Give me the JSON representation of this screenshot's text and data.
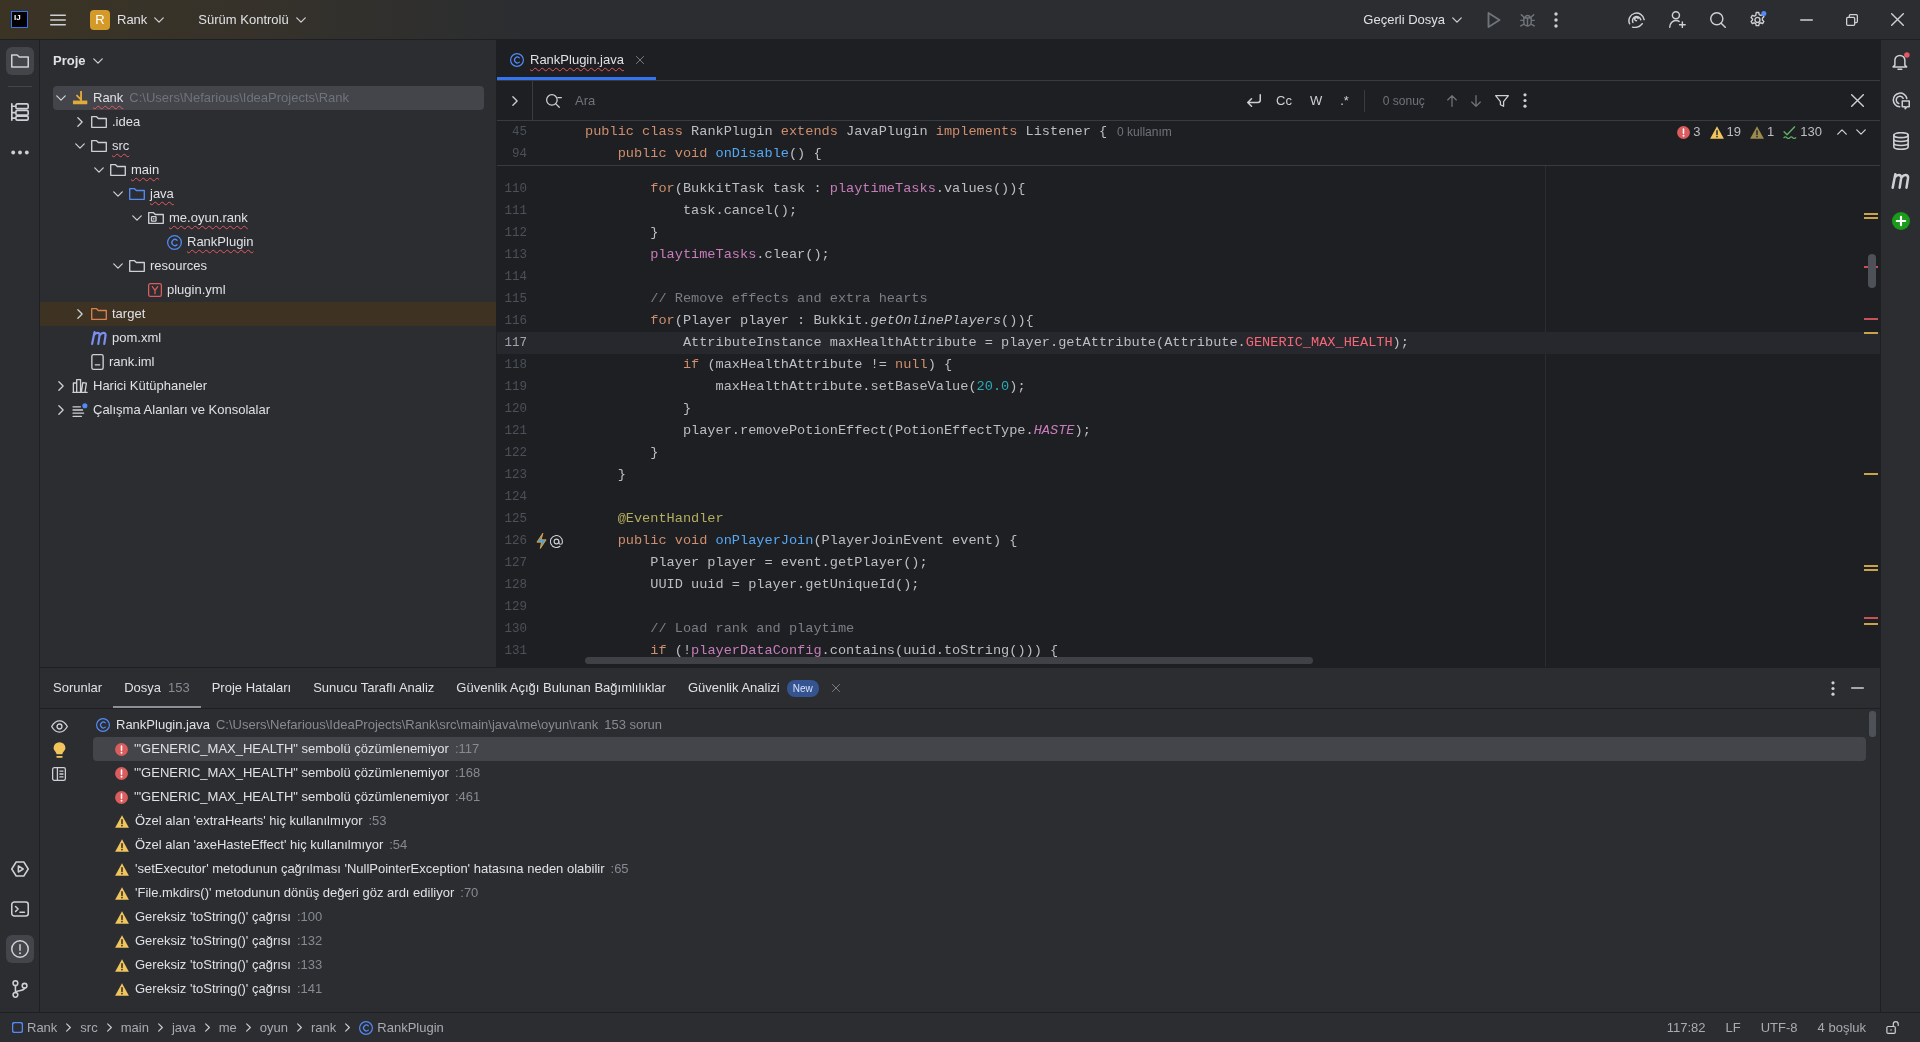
{
  "title_bar": {
    "logo": "IJ",
    "project_badge": "R",
    "project_name": "Rank",
    "vcs_menu": "Sürüm Kontrolü",
    "run_configuration": "Geçerli Dosya",
    "actions": [
      {
        "kind": "run",
        "disabled": true
      },
      {
        "kind": "debug",
        "disabled": true
      }
    ]
  },
  "left_toolbar": {
    "top": [
      {
        "kind": "project",
        "selected": true
      },
      {
        "kind": "structure",
        "selected": false
      },
      {
        "kind": "more",
        "selected": false
      }
    ],
    "bottom": [
      {
        "kind": "services",
        "selected": false
      },
      {
        "kind": "terminal",
        "selected": false
      },
      {
        "kind": "problems",
        "selected": true
      },
      {
        "kind": "git",
        "selected": false
      }
    ]
  },
  "project_panel": {
    "title": "Proje",
    "tree": [
      {
        "label": "Rank",
        "path": "C:\\Users\\Nefarious\\IdeaProjects\\Rank",
        "kind": "module",
        "expanded": true,
        "selected": true,
        "error": true,
        "children": [
          {
            "label": ".idea",
            "kind": "folder",
            "expanded": false,
            "selected": false,
            "error": false
          },
          {
            "label": "src",
            "kind": "folder",
            "expanded": true,
            "selected": false,
            "error": true,
            "children": [
              {
                "label": "main",
                "kind": "folder",
                "expanded": true,
                "selected": false,
                "error": true,
                "children": [
                  {
                    "label": "java",
                    "kind": "source-folder",
                    "expanded": true,
                    "selected": false,
                    "error": true,
                    "children": [
                      {
                        "label": "me.oyun.rank",
                        "kind": "package",
                        "expanded": true,
                        "selected": false,
                        "error": true,
                        "children": [
                          {
                            "label": "RankPlugin",
                            "kind": "class",
                            "selected": false,
                            "error": true
                          }
                        ]
                      }
                    ]
                  },
                  {
                    "label": "resources",
                    "kind": "folder",
                    "expanded": true,
                    "selected": false,
                    "error": false,
                    "children": [
                      {
                        "label": "plugin.yml",
                        "kind": "yaml",
                        "selected": false,
                        "error": false
                      }
                    ]
                  }
                ]
              }
            ]
          },
          {
            "label": "target",
            "kind": "excluded-folder",
            "expanded": false,
            "selected": false,
            "error": false
          },
          {
            "label": "pom.xml",
            "kind": "maven",
            "selected": false,
            "error": false
          },
          {
            "label": "rank.iml",
            "kind": "file",
            "selected": false,
            "error": false
          }
        ]
      },
      {
        "label": "Harici Kütüphaneler",
        "kind": "library",
        "expanded": false,
        "selected": false,
        "error": false
      },
      {
        "label": "Çalışma Alanları ve Konsolalar",
        "kind": "scratches",
        "expanded": false,
        "selected": false,
        "error": false
      }
    ]
  },
  "editor": {
    "tabs": [
      {
        "label": "RankPlugin.java",
        "kind": "class",
        "selected": true,
        "error": true
      }
    ],
    "find_bar": {
      "placeholder": "Ara",
      "options": [
        "Cc",
        "W",
        ".*"
      ],
      "result": "0 sonuç"
    },
    "sticky_lines": [
      {
        "number": "45",
        "tokens": [
          {
            "kind": "keyword",
            "text": "public class "
          },
          {
            "kind": "plain",
            "text": "RankPlugin "
          },
          {
            "kind": "keyword",
            "text": "extends "
          },
          {
            "kind": "plain",
            "text": "JavaPlugin "
          },
          {
            "kind": "keyword",
            "text": "implements "
          },
          {
            "kind": "plain",
            "text": "Listener {"
          }
        ],
        "hint": "0 kullanım"
      },
      {
        "number": "94",
        "tokens": [
          {
            "kind": "keyword",
            "text": "    public void "
          },
          {
            "kind": "method_declaration",
            "text": "onDisable"
          },
          {
            "kind": "plain",
            "text": "() {"
          }
        ]
      }
    ],
    "inspections": [
      {
        "kind": "error",
        "count": "3"
      },
      {
        "kind": "warning",
        "count": "19"
      },
      {
        "kind": "weak_warning",
        "count": "1"
      },
      {
        "kind": "typo",
        "count": "130"
      }
    ],
    "lines": [
      {
        "number": "110",
        "current": false,
        "tokens": [
          {
            "kind": "keyword",
            "text": "        for"
          },
          {
            "kind": "plain",
            "text": "(BukkitTask task : "
          },
          {
            "kind": "field",
            "text": "playtimeTasks"
          },
          {
            "kind": "plain",
            "text": ".values()){"
          }
        ]
      },
      {
        "number": "111",
        "current": false,
        "tokens": [
          {
            "kind": "plain",
            "text": "            task.cancel();"
          }
        ]
      },
      {
        "number": "112",
        "current": false,
        "tokens": [
          {
            "kind": "plain",
            "text": "        }"
          }
        ]
      },
      {
        "number": "113",
        "current": false,
        "tokens": [
          {
            "kind": "field",
            "text": "        playtimeTasks"
          },
          {
            "kind": "plain",
            "text": ".clear();"
          }
        ]
      },
      {
        "number": "114",
        "current": false
      },
      {
        "number": "115",
        "current": false,
        "tokens": [
          {
            "kind": "comment",
            "text": "        // Remove effects and extra hearts"
          }
        ]
      },
      {
        "number": "116",
        "current": false,
        "tokens": [
          {
            "kind": "keyword",
            "text": "        for"
          },
          {
            "kind": "plain",
            "text": "(Player player : Bukkit."
          },
          {
            "kind": "static_method",
            "text": "getOnlinePlayers"
          },
          {
            "kind": "plain",
            "text": "()){"
          }
        ]
      },
      {
        "number": "117",
        "current": true,
        "tokens": [
          {
            "kind": "plain",
            "text": "            AttributeInstance maxHealthAttribute = player.getAttribute(Attribute."
          },
          {
            "kind": "unresolved",
            "text": "GENERIC_MAX_HEALTH"
          },
          {
            "kind": "plain",
            "text": ");"
          }
        ]
      },
      {
        "number": "118",
        "current": false,
        "tokens": [
          {
            "kind": "keyword",
            "text": "            if "
          },
          {
            "kind": "plain",
            "text": "(maxHealthAttribute != "
          },
          {
            "kind": "keyword",
            "text": "null"
          },
          {
            "kind": "plain",
            "text": ") {"
          }
        ]
      },
      {
        "number": "119",
        "current": false,
        "tokens": [
          {
            "kind": "plain",
            "text": "                maxHealthAttribute.setBaseValue("
          },
          {
            "kind": "number",
            "text": "20.0"
          },
          {
            "kind": "plain",
            "text": ");"
          }
        ]
      },
      {
        "number": "120",
        "current": false,
        "tokens": [
          {
            "kind": "plain",
            "text": "            }"
          }
        ]
      },
      {
        "number": "121",
        "current": false,
        "tokens": [
          {
            "kind": "plain",
            "text": "            player.removePotionEffect(PotionEffectType."
          },
          {
            "kind": "static_field",
            "text": "HASTE"
          },
          {
            "kind": "plain",
            "text": ");"
          }
        ]
      },
      {
        "number": "122",
        "current": false,
        "tokens": [
          {
            "kind": "plain",
            "text": "        }"
          }
        ]
      },
      {
        "number": "123",
        "current": false,
        "tokens": [
          {
            "kind": "plain",
            "text": "    }"
          }
        ]
      },
      {
        "number": "124",
        "current": false
      },
      {
        "number": "125",
        "current": false,
        "tokens": [
          {
            "kind": "annotation",
            "text": "    @EventHandler"
          }
        ]
      },
      {
        "number": "126",
        "current": false,
        "gutter": [
          {
            "kind": "bolt"
          },
          {
            "kind": "at"
          }
        ],
        "tokens": [
          {
            "kind": "keyword",
            "text": "    public void "
          },
          {
            "kind": "method_declaration",
            "text": "onPlayerJoin"
          },
          {
            "kind": "plain",
            "text": "(PlayerJoinEvent event) {"
          }
        ]
      },
      {
        "number": "127",
        "current": false,
        "tokens": [
          {
            "kind": "plain",
            "text": "        Player player = event.getPlayer();"
          }
        ]
      },
      {
        "number": "128",
        "current": false,
        "tokens": [
          {
            "kind": "plain",
            "text": "        UUID uuid = player.getUniqueId();"
          }
        ]
      },
      {
        "number": "129",
        "current": false
      },
      {
        "number": "130",
        "current": false,
        "tokens": [
          {
            "kind": "comment",
            "text": "        // Load rank and playtime"
          }
        ]
      },
      {
        "number": "131",
        "current": false,
        "tokens": [
          {
            "kind": "keyword",
            "text": "        if "
          },
          {
            "kind": "plain",
            "text": "(!"
          },
          {
            "kind": "field",
            "text": "playerDataConfig"
          },
          {
            "kind": "plain",
            "text": ".contains(uuid.toString())) {"
          }
        ]
      }
    ]
  },
  "right_toolbar": [
    {
      "kind": "notifications"
    },
    {
      "kind": "ai_chat"
    },
    {
      "kind": "database"
    },
    {
      "kind": "maven"
    },
    {
      "kind": "plugin"
    }
  ],
  "problems_panel": {
    "title": "Sorunlar",
    "tabs": [
      {
        "label": "Dosya",
        "count": "153",
        "selected": true
      },
      {
        "label": "Proje Hataları",
        "selected": false
      },
      {
        "label": "Sunucu Taraflı Analiz",
        "selected": false
      },
      {
        "label": "Güvenlik Açığı Bulunan Bağımlılıklar",
        "selected": false
      },
      {
        "label": "Güvenlik Analizi",
        "badge": "New",
        "closable": true,
        "selected": false
      }
    ],
    "file": {
      "kind": "class",
      "name": "RankPlugin.java",
      "path": "C:\\Users\\Nefarious\\IdeaProjects\\Rank\\src\\main\\java\\me\\oyun\\rank",
      "summary": "153 sorun"
    },
    "items": [
      {
        "kind": "error",
        "message": "'\"GENERIC_MAX_HEALTH\" sembolü çözümlenemiyor",
        "line": ":117",
        "selected": true
      },
      {
        "kind": "error",
        "message": "'\"GENERIC_MAX_HEALTH\" sembolü çözümlenemiyor",
        "line": ":168",
        "selected": false
      },
      {
        "kind": "error",
        "message": "'\"GENERIC_MAX_HEALTH\" sembolü çözümlenemiyor",
        "line": ":461",
        "selected": false
      },
      {
        "kind": "warning",
        "message": "Özel alan 'extraHearts' hiç kullanılmıyor",
        "line": ":53",
        "selected": false
      },
      {
        "kind": "warning",
        "message": "Özel alan 'axeHasteEffect' hiç kullanılmıyor",
        "line": ":54",
        "selected": false
      },
      {
        "kind": "warning",
        "message": "'setExecutor' metodunun çağrılması 'NullPointerException' hatasına neden olabilir",
        "line": ":65",
        "selected": false
      },
      {
        "kind": "warning",
        "message": "'File.mkdirs()' metodunun dönüş değeri göz ardı ediliyor",
        "line": ":70",
        "selected": false
      },
      {
        "kind": "warning",
        "message": "Gereksiz 'toString()' çağrısı",
        "line": ":100",
        "selected": false
      },
      {
        "kind": "warning",
        "message": "Gereksiz 'toString()' çağrısı",
        "line": ":132",
        "selected": false
      },
      {
        "kind": "warning",
        "message": "Gereksiz 'toString()' çağrısı",
        "line": ":133",
        "selected": false
      },
      {
        "kind": "warning",
        "message": "Gereksiz 'toString()' çağrısı",
        "line": ":141",
        "selected": false
      }
    ]
  },
  "status_bar": {
    "breadcrumbs": [
      {
        "kind": "module",
        "label": "Rank"
      },
      {
        "kind": "dir",
        "label": "src"
      },
      {
        "kind": "dir",
        "label": "main"
      },
      {
        "kind": "dir",
        "label": "java"
      },
      {
        "kind": "dir",
        "label": "me"
      },
      {
        "kind": "dir",
        "label": "oyun"
      },
      {
        "kind": "dir",
        "label": "rank"
      },
      {
        "kind": "class",
        "label": "RankPlugin"
      }
    ],
    "caret": "117:82",
    "line_separator": "LF",
    "encoding": "UTF-8",
    "indent": "4 boşluk"
  }
}
